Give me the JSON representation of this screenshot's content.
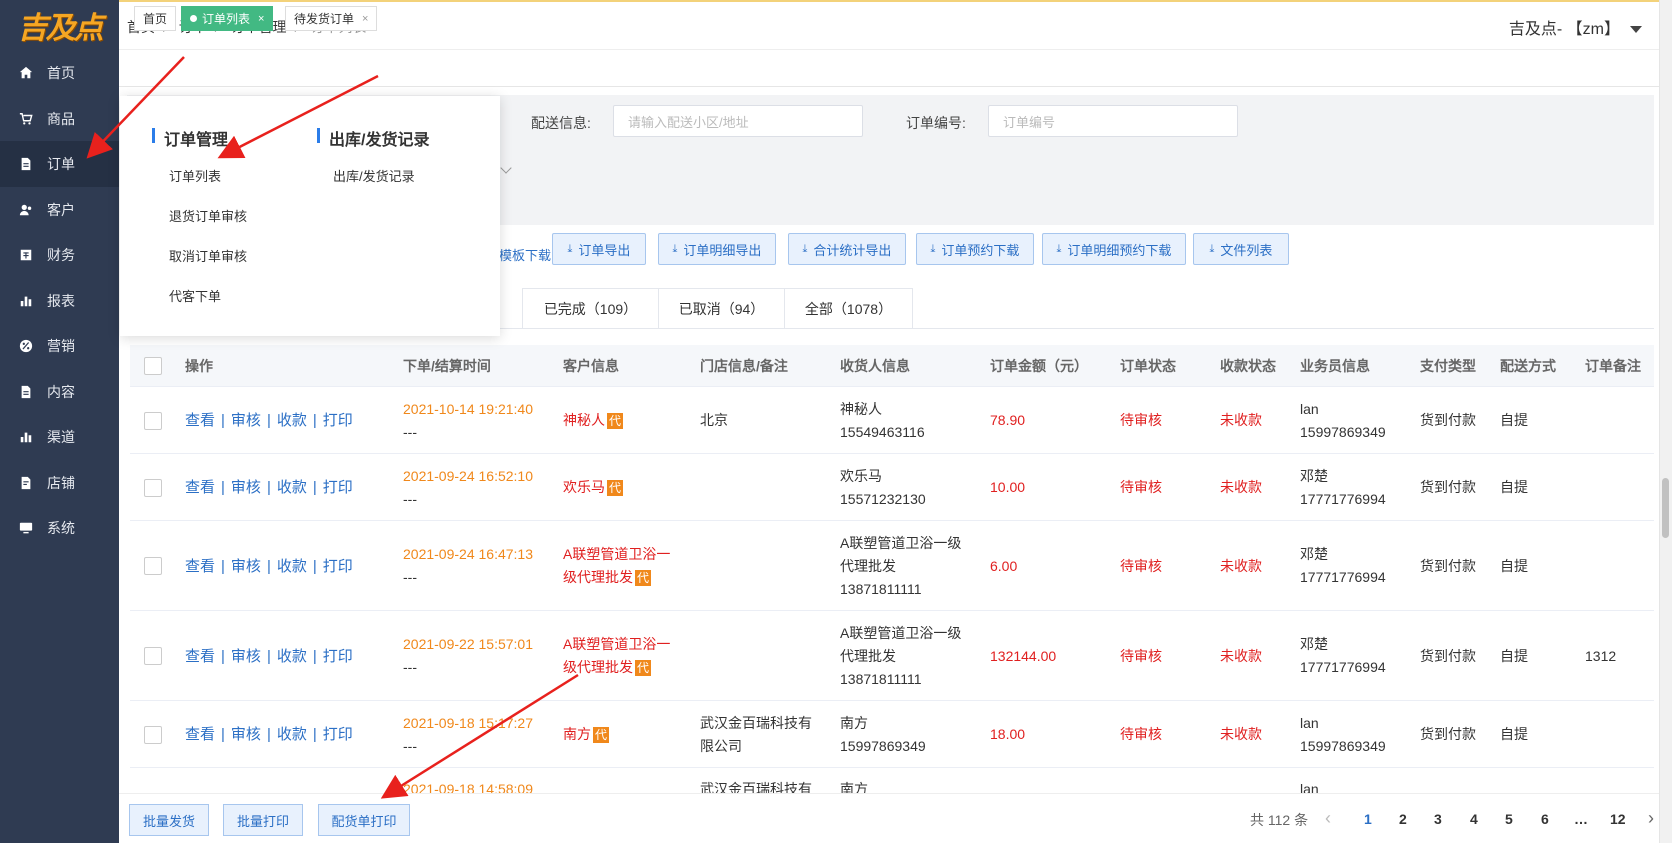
{
  "logo": {
    "text": "吉及点"
  },
  "sidebar": {
    "items": [
      {
        "label": "首页",
        "icon": "home-icon"
      },
      {
        "label": "商品",
        "icon": "cart-icon"
      },
      {
        "label": "订单",
        "icon": "order-icon"
      },
      {
        "label": "客户",
        "icon": "user-icon"
      },
      {
        "label": "财务",
        "icon": "finance-icon"
      },
      {
        "label": "报表",
        "icon": "bar-chart-icon"
      },
      {
        "label": "营销",
        "icon": "percent-icon"
      },
      {
        "label": "内容",
        "icon": "document-icon"
      },
      {
        "label": "渠道",
        "icon": "bar-chart-icon"
      },
      {
        "label": "店铺",
        "icon": "store-icon"
      },
      {
        "label": "系统",
        "icon": "monitor-icon"
      }
    ],
    "active": "订单"
  },
  "breadcrumb": [
    "首页",
    "订单",
    "订单管理",
    "订单列表"
  ],
  "user": {
    "name": "吉及点- 【zm】"
  },
  "tabs": [
    {
      "label": "首页"
    },
    {
      "label": "订单列表",
      "close": "×"
    },
    {
      "label": "待发货订单",
      "close": "×"
    }
  ],
  "filters": {
    "delivery_label": "配送信息:",
    "delivery_placeholder": "请输入配送小区/地址",
    "orderno_label": "订单编号:",
    "orderno_placeholder": "订单编号"
  },
  "dropdown": {
    "col1_title": "订单管理",
    "col1_items": [
      "订单列表",
      "退货订单审核",
      "取消订单审核",
      "代客下单"
    ],
    "col2_title": "出库/发货记录",
    "col2_items": [
      "出库/发货记录"
    ]
  },
  "toolbar": {
    "template_link": "模板下载",
    "buttons": [
      "订单导出",
      "订单明细导出",
      "合计统计导出",
      "订单预约下载",
      "订单明细预约下载",
      "文件列表"
    ]
  },
  "status_tabs": [
    "已完成（109）",
    "已取消（94）",
    "全部（1078）"
  ],
  "table": {
    "headers": [
      "操作",
      "下单/结算时间",
      "客户信息",
      "门店信息/备注",
      "收货人信息",
      "订单金额（元）",
      "订单状态",
      "收款状态",
      "业务员信息",
      "支付类型",
      "配送方式",
      "订单备注"
    ],
    "ops": [
      "查看",
      "审核",
      "收款",
      "打印"
    ],
    "agent_badge": "代",
    "rows": [
      {
        "time": "2021-10-14 19:21:40",
        "time2": "---",
        "customer": "神秘人",
        "store": "北京",
        "receiver": [
          "神秘人",
          "15549463116"
        ],
        "amount": "78.90",
        "status": "待审核",
        "pay_status": "未收款",
        "sales": [
          "lan",
          "15997869349"
        ],
        "pay_type": "货到付款",
        "delivery": "自提",
        "remark": ""
      },
      {
        "time": "2021-09-24 16:52:10",
        "time2": "---",
        "customer": "欢乐马",
        "store": "",
        "receiver": [
          "欢乐马",
          "15571232130"
        ],
        "amount": "10.00",
        "status": "待审核",
        "pay_status": "未收款",
        "sales": [
          "邓楚",
          "17771776994"
        ],
        "pay_type": "货到付款",
        "delivery": "自提",
        "remark": ""
      },
      {
        "time": "2021-09-24 16:47:13",
        "time2": "---",
        "customer": [
          "A联塑管道卫浴一",
          "级代理批发"
        ],
        "store": "",
        "receiver": [
          "A联塑管道卫浴一级",
          "代理批发",
          "13871811111"
        ],
        "amount": "6.00",
        "status": "待审核",
        "pay_status": "未收款",
        "sales": [
          "邓楚",
          "17771776994"
        ],
        "pay_type": "货到付款",
        "delivery": "自提",
        "remark": ""
      },
      {
        "time": "2021-09-22 15:57:01",
        "time2": "---",
        "customer": [
          "A联塑管道卫浴一",
          "级代理批发"
        ],
        "store": "",
        "receiver": [
          "A联塑管道卫浴一级",
          "代理批发",
          "13871811111"
        ],
        "amount": "132144.00",
        "status": "待审核",
        "pay_status": "未收款",
        "sales": [
          "邓楚",
          "17771776994"
        ],
        "pay_type": "货到付款",
        "delivery": "自提",
        "remark": "1312"
      },
      {
        "time": "2021-09-18 15:17:27",
        "time2": "---",
        "customer": "南方",
        "store": [
          "武汉金百瑞科技有",
          "限公司"
        ],
        "receiver": [
          "南方",
          "15997869349"
        ],
        "amount": "18.00",
        "status": "待审核",
        "pay_status": "未收款",
        "sales": [
          "lan",
          "15997869349"
        ],
        "pay_type": "货到付款",
        "delivery": "自提",
        "remark": ""
      },
      {
        "time": "2021-09-18 14:58:09",
        "store": "武汉金百瑞科技有",
        "receiver": [
          "南方"
        ],
        "sales": [
          "lan"
        ]
      }
    ]
  },
  "footer": {
    "buttons": [
      "批量发货",
      "批量打印",
      "配货单打印"
    ],
    "total": "共 112 条",
    "pages": [
      "1",
      "2",
      "3",
      "4",
      "5",
      "6",
      "…",
      "12"
    ],
    "prev": "‹",
    "next": "›"
  },
  "colors": {
    "sidebar": "#2f3b52",
    "accent": "#2b6fc5",
    "tab_active": "#42b983",
    "warning": "#f0881b",
    "danger": "#e02020",
    "annotation_arrow": "#e8211d"
  }
}
